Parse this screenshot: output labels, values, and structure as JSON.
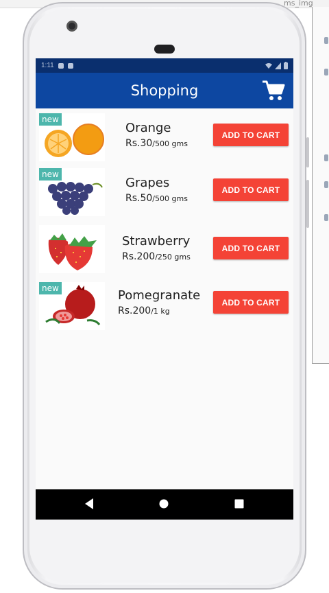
{
  "colors": {
    "status_bar": "#0a2f6e",
    "app_bar": "#0d47a1",
    "badge": "#4db6ac",
    "button": "#f44336",
    "nav_bar": "#000000"
  },
  "app": {
    "title": "Shopping",
    "cart_icon": "shopping-cart-icon"
  },
  "status_bar": {
    "time": "1:11"
  },
  "background": {
    "label": "ms_img"
  },
  "products": [
    {
      "badge": "new",
      "name": "Orange",
      "price": "Rs.30",
      "qty": "/500 gms",
      "button": "ADD TO CART",
      "image": "orange"
    },
    {
      "badge": "new",
      "name": "Grapes",
      "price": "Rs.50",
      "qty": "/500 gms",
      "button": "ADD TO CART",
      "image": "grapes"
    },
    {
      "badge": "",
      "name": "Strawberry",
      "price": "Rs.200",
      "qty": "/250 gms",
      "button": "ADD TO CART",
      "image": "strawberry"
    },
    {
      "badge": "new",
      "name": "Pomegranate",
      "price": "Rs.200",
      "qty": "/1 kg",
      "button": "ADD TO CART",
      "image": "pomegranate"
    }
  ],
  "nav": {
    "back_icon": "back-icon",
    "home_icon": "home-icon",
    "recents_icon": "recents-icon"
  }
}
